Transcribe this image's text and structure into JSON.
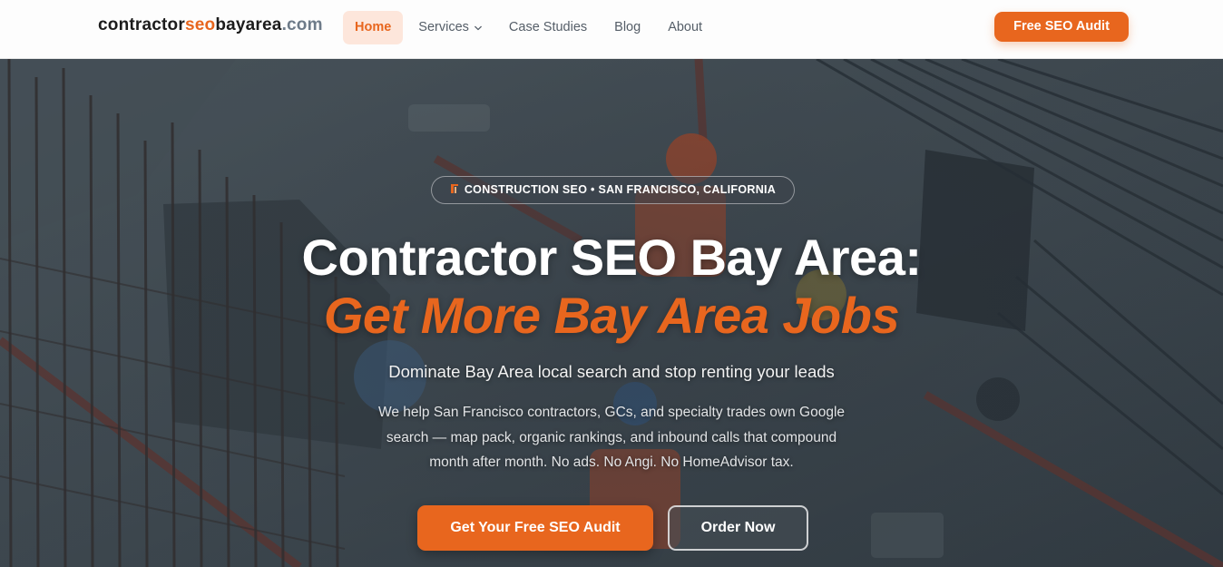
{
  "nav": {
    "logo": {
      "part1": "contractor",
      "part2": "seo",
      "part3": "bayarea",
      "part4": ".com"
    },
    "links": [
      {
        "label": "Home",
        "active": true
      },
      {
        "label": "Services",
        "dropdown": true
      },
      {
        "label": "Case Studies"
      },
      {
        "label": "Blog"
      },
      {
        "label": "About"
      }
    ],
    "cta": "Free SEO Audit"
  },
  "hero": {
    "badge": "CONSTRUCTION SEO • SAN FRANCISCO, CALIFORNIA",
    "title_line1": "Contractor SEO Bay Area:",
    "title_line2": "Get More Bay Area Jobs",
    "subtitle": "Dominate Bay Area local search and stop renting your leads",
    "description": "We help San Francisco contractors, GCs, and specialty trades own Google search — map pack, organic rankings, and inbound calls that compound month after month. No ads. No Angi. No HomeAdvisor tax.",
    "primary_button": "Get Your Free SEO Audit",
    "secondary_button": "Order Now"
  },
  "colors": {
    "accent": "#e8661e",
    "accent_light": "#fde6db",
    "text_dark": "#1c1c1c",
    "muted": "#6e7b89"
  },
  "icons": {
    "services_dropdown": "chevron-down-icon",
    "badge": "building-icon"
  }
}
